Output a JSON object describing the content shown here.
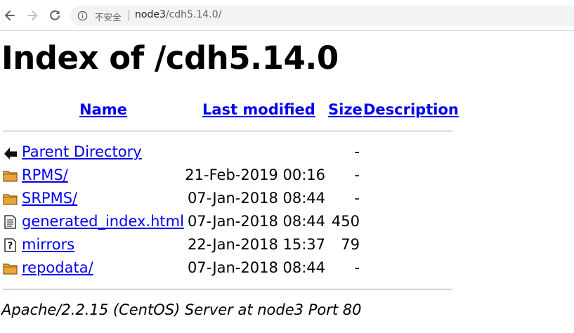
{
  "browser": {
    "security_label": "不安全",
    "url_host": "node3",
    "url_path": "/cdh5.14.0/"
  },
  "page": {
    "title": "Index of /cdh5.14.0",
    "columns": {
      "name": "Name",
      "last_modified": "Last modified",
      "size": "Size",
      "description": "Description"
    },
    "rows": [
      {
        "icon": "back-icon",
        "name": "Parent Directory",
        "modified": "",
        "size": "-"
      },
      {
        "icon": "folder-icon",
        "name": "RPMS/",
        "modified": "21-Feb-2019 00:16",
        "size": "-"
      },
      {
        "icon": "folder-icon",
        "name": "SRPMS/",
        "modified": "07-Jan-2018 08:44",
        "size": "-"
      },
      {
        "icon": "text-file-icon",
        "name": "generated_index.html",
        "modified": "07-Jan-2018 08:44",
        "size": "450"
      },
      {
        "icon": "unknown-file-icon",
        "name": "mirrors",
        "modified": "22-Jan-2018 15:37",
        "size": "79"
      },
      {
        "icon": "folder-icon",
        "name": "repodata/",
        "modified": "07-Jan-2018 08:44",
        "size": "-"
      }
    ],
    "footer": "Apache/2.2.15 (CentOS) Server at node3 Port 80"
  },
  "colors": {
    "link": "#0000ee",
    "folder_fill": "#e8a53a",
    "folder_stroke": "#8a5a10",
    "rule": "#9a9a9a"
  }
}
